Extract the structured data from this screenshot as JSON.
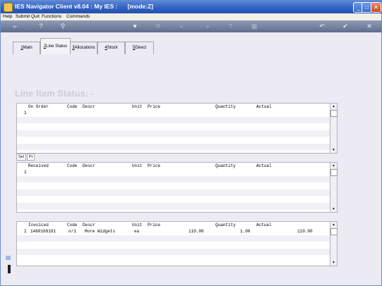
{
  "window": {
    "title": "IES Navigator Client v8.04 : My IES :      [mode:Z]"
  },
  "menu": [
    "Help",
    "Submit",
    "Quit",
    "Functions",
    "Commands"
  ],
  "toolbar": {
    "icons": [
      "key-icon",
      "info-icon",
      "search-icon",
      "heart-icon",
      "refresh-icon",
      "rewind-icon",
      "fast-forward-icon",
      "tree-icon",
      "page-icon",
      "back-icon",
      "ok-icon",
      "cancel-icon"
    ],
    "glyphs": [
      "⟜",
      "?",
      "⚲",
      "♥",
      "⟳",
      "«",
      "»",
      "⇡",
      "▦",
      "↶",
      "✔",
      "✕"
    ]
  },
  "tabs": [
    {
      "key": "1",
      "label": "Main"
    },
    {
      "key": "2",
      "label": "Line Status"
    },
    {
      "key": "3",
      "label": "Allocations"
    },
    {
      "key": "4",
      "label": "Stock"
    },
    {
      "key": "5",
      "label": "Direct"
    }
  ],
  "page_title": "Line Item Status: -",
  "grid_order": {
    "headers": [
      "On Order",
      "Code",
      "Descr",
      "Unit",
      "Price",
      "Quantity",
      "Actual"
    ],
    "rows": [
      {
        "n": "1",
        "cells": [
          "",
          "",
          "",
          "",
          "",
          "",
          ""
        ]
      }
    ]
  },
  "mini_tabs": [
    "Sel",
    "Pr"
  ],
  "grid_received": {
    "headers": [
      "Received",
      "Code",
      "Descr",
      "Unit",
      "Price",
      "Quantity",
      "Actual"
    ],
    "rows": [
      {
        "n": "1",
        "cells": [
          "",
          "",
          "",
          "",
          "",
          "",
          ""
        ]
      }
    ]
  },
  "grid_invoiced": {
    "headers": [
      "Invoiced",
      "Code",
      "Descr",
      "Unit",
      "Price",
      "Quantity",
      "Actual"
    ],
    "rows": [
      {
        "n": "1",
        "cells": [
          "1460168191",
          "n/1",
          "More Widgets",
          "ea",
          "110.00",
          "1.00",
          "110.00"
        ]
      }
    ]
  }
}
